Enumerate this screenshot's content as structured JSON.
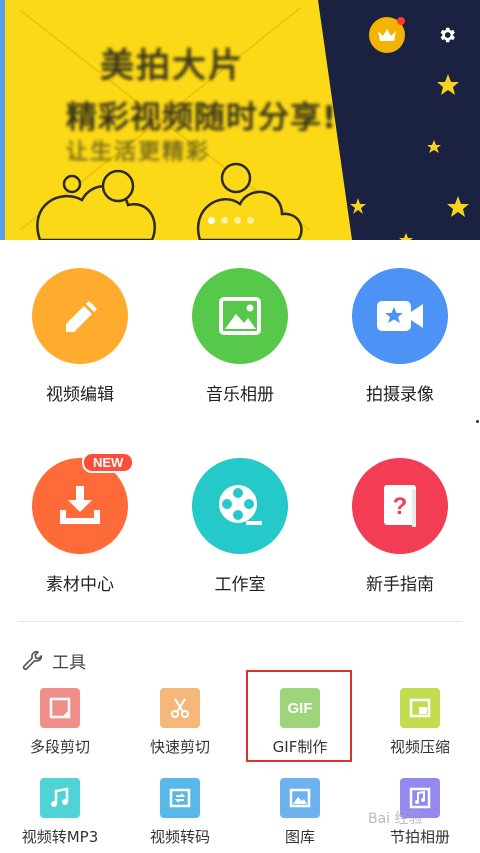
{
  "banner": {
    "headline": "美拍大片",
    "subtitle": "精彩视频随时分享!",
    "tagline": "让生活更精彩",
    "carousel_total": 4,
    "carousel_active": 0,
    "colors": {
      "yellow": "#fcd916",
      "navy": "#1b2140",
      "star": "#f7d21f"
    }
  },
  "header_icons": {
    "vip": "crown-icon",
    "settings": "gear-icon"
  },
  "features": [
    {
      "label": "视频编辑",
      "icon": "pencil-icon",
      "color": "#ffab2e"
    },
    {
      "label": "音乐相册",
      "icon": "image-icon",
      "color": "#57c94a"
    },
    {
      "label": "拍摄录像",
      "icon": "video-camera-icon",
      "color": "#4d93f5"
    },
    {
      "label": "素材中心",
      "icon": "download-icon",
      "color": "#ff6b38",
      "badge": "NEW"
    },
    {
      "label": "工作室",
      "icon": "film-reel-icon",
      "color": "#26c9c9"
    },
    {
      "label": "新手指南",
      "icon": "help-book-icon",
      "color": "#f23d55"
    }
  ],
  "tools": {
    "title": "工具",
    "items": [
      {
        "label": "多段剪切",
        "icon": "trim-icon",
        "color": "#f08f87"
      },
      {
        "label": "快速剪切",
        "icon": "scissors-icon",
        "color": "#f5b87a"
      },
      {
        "label": "GIF制作",
        "icon": "gif-icon",
        "icon_text": "GIF",
        "color": "#9ed47a"
      },
      {
        "label": "视频压缩",
        "icon": "compress-icon",
        "color": "#c1dc4e"
      },
      {
        "label": "视频转MP3",
        "icon": "music-note-icon",
        "color": "#4fd3d6"
      },
      {
        "label": "视频转码",
        "icon": "convert-icon",
        "color": "#58b9e8"
      },
      {
        "label": "图库",
        "icon": "gallery-icon",
        "color": "#6db2ee"
      },
      {
        "label": "节拍相册",
        "icon": "beat-album-icon",
        "color": "#9489f0"
      }
    ]
  },
  "watermark": "Bai 经验"
}
